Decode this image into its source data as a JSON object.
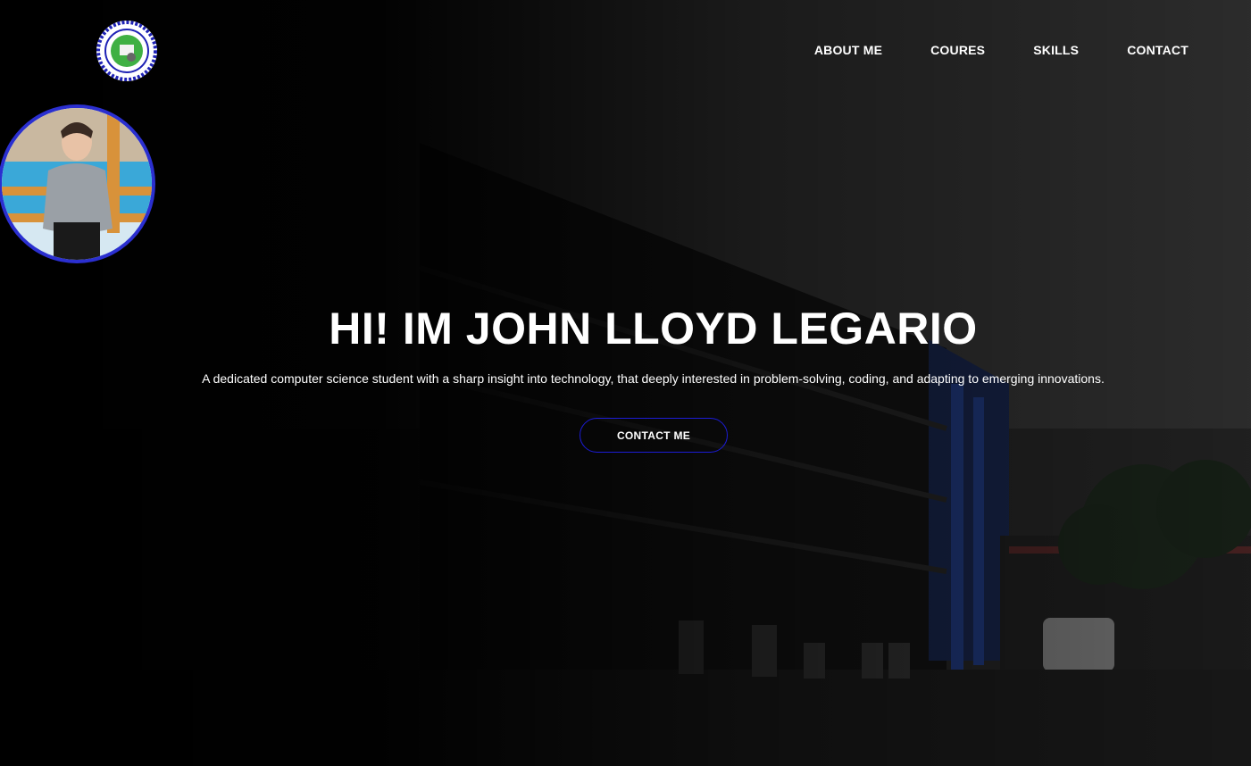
{
  "header": {
    "logo_icon": "college-seal-icon",
    "nav": [
      {
        "label": "ABOUT ME"
      },
      {
        "label": "COURES"
      },
      {
        "label": "SKILLS"
      },
      {
        "label": "CONTACT"
      }
    ]
  },
  "profile": {
    "avatar_icon": "profile-photo",
    "border_color": "#2b2fd0"
  },
  "hero": {
    "title": "HI! IM JOHN LLOYD LEGARIO",
    "tagline": "A dedicated computer science student with a sharp insight into technology, that deeply interested in problem-solving, coding, and adapting to emerging innovations.",
    "cta_label": "CONTACT ME",
    "accent": "#1c1cd6"
  }
}
